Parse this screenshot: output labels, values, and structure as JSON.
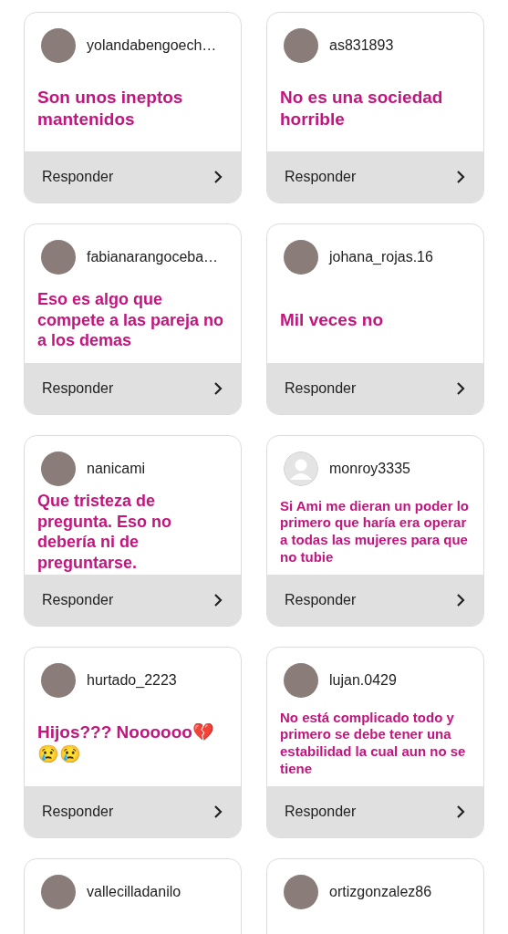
{
  "cards": [
    {
      "username": "yolandabengoech…",
      "comment": "Son unos ineptos mantenidos",
      "reply": "Responder"
    },
    {
      "username": "as831893",
      "comment": "No es una sociedad horrible",
      "reply": "Responder"
    },
    {
      "username": "fabianarangoceba…",
      "comment": "Eso es algo que compete a las pareja no a los demas",
      "reply": "Responder"
    },
    {
      "username": "johana_rojas.16",
      "comment": "Mil veces no",
      "reply": "Responder"
    },
    {
      "username": "nanicami",
      "comment": "Que tristeza de pregunta. Eso no debería ni de preguntarse.",
      "reply": "Responder"
    },
    {
      "username": "monroy3335",
      "kind": "default-avatar",
      "comment": "Si Ami me dieran un poder lo primero que haría era operar a todas las mujeres para que no tubie",
      "reply": "Responder"
    },
    {
      "username": "hurtado_2223",
      "comment": "Hijos??? Noooooo💔 😢😢",
      "reply": "Responder"
    },
    {
      "username": "lujan.0429",
      "comment": "No está complicado todo y primero se debe tener una estabilidad la cual  aun no se tiene",
      "reply": "Responder"
    },
    {
      "username": "vallecilladanilo"
    },
    {
      "username": "ortizgonzalez86"
    }
  ]
}
